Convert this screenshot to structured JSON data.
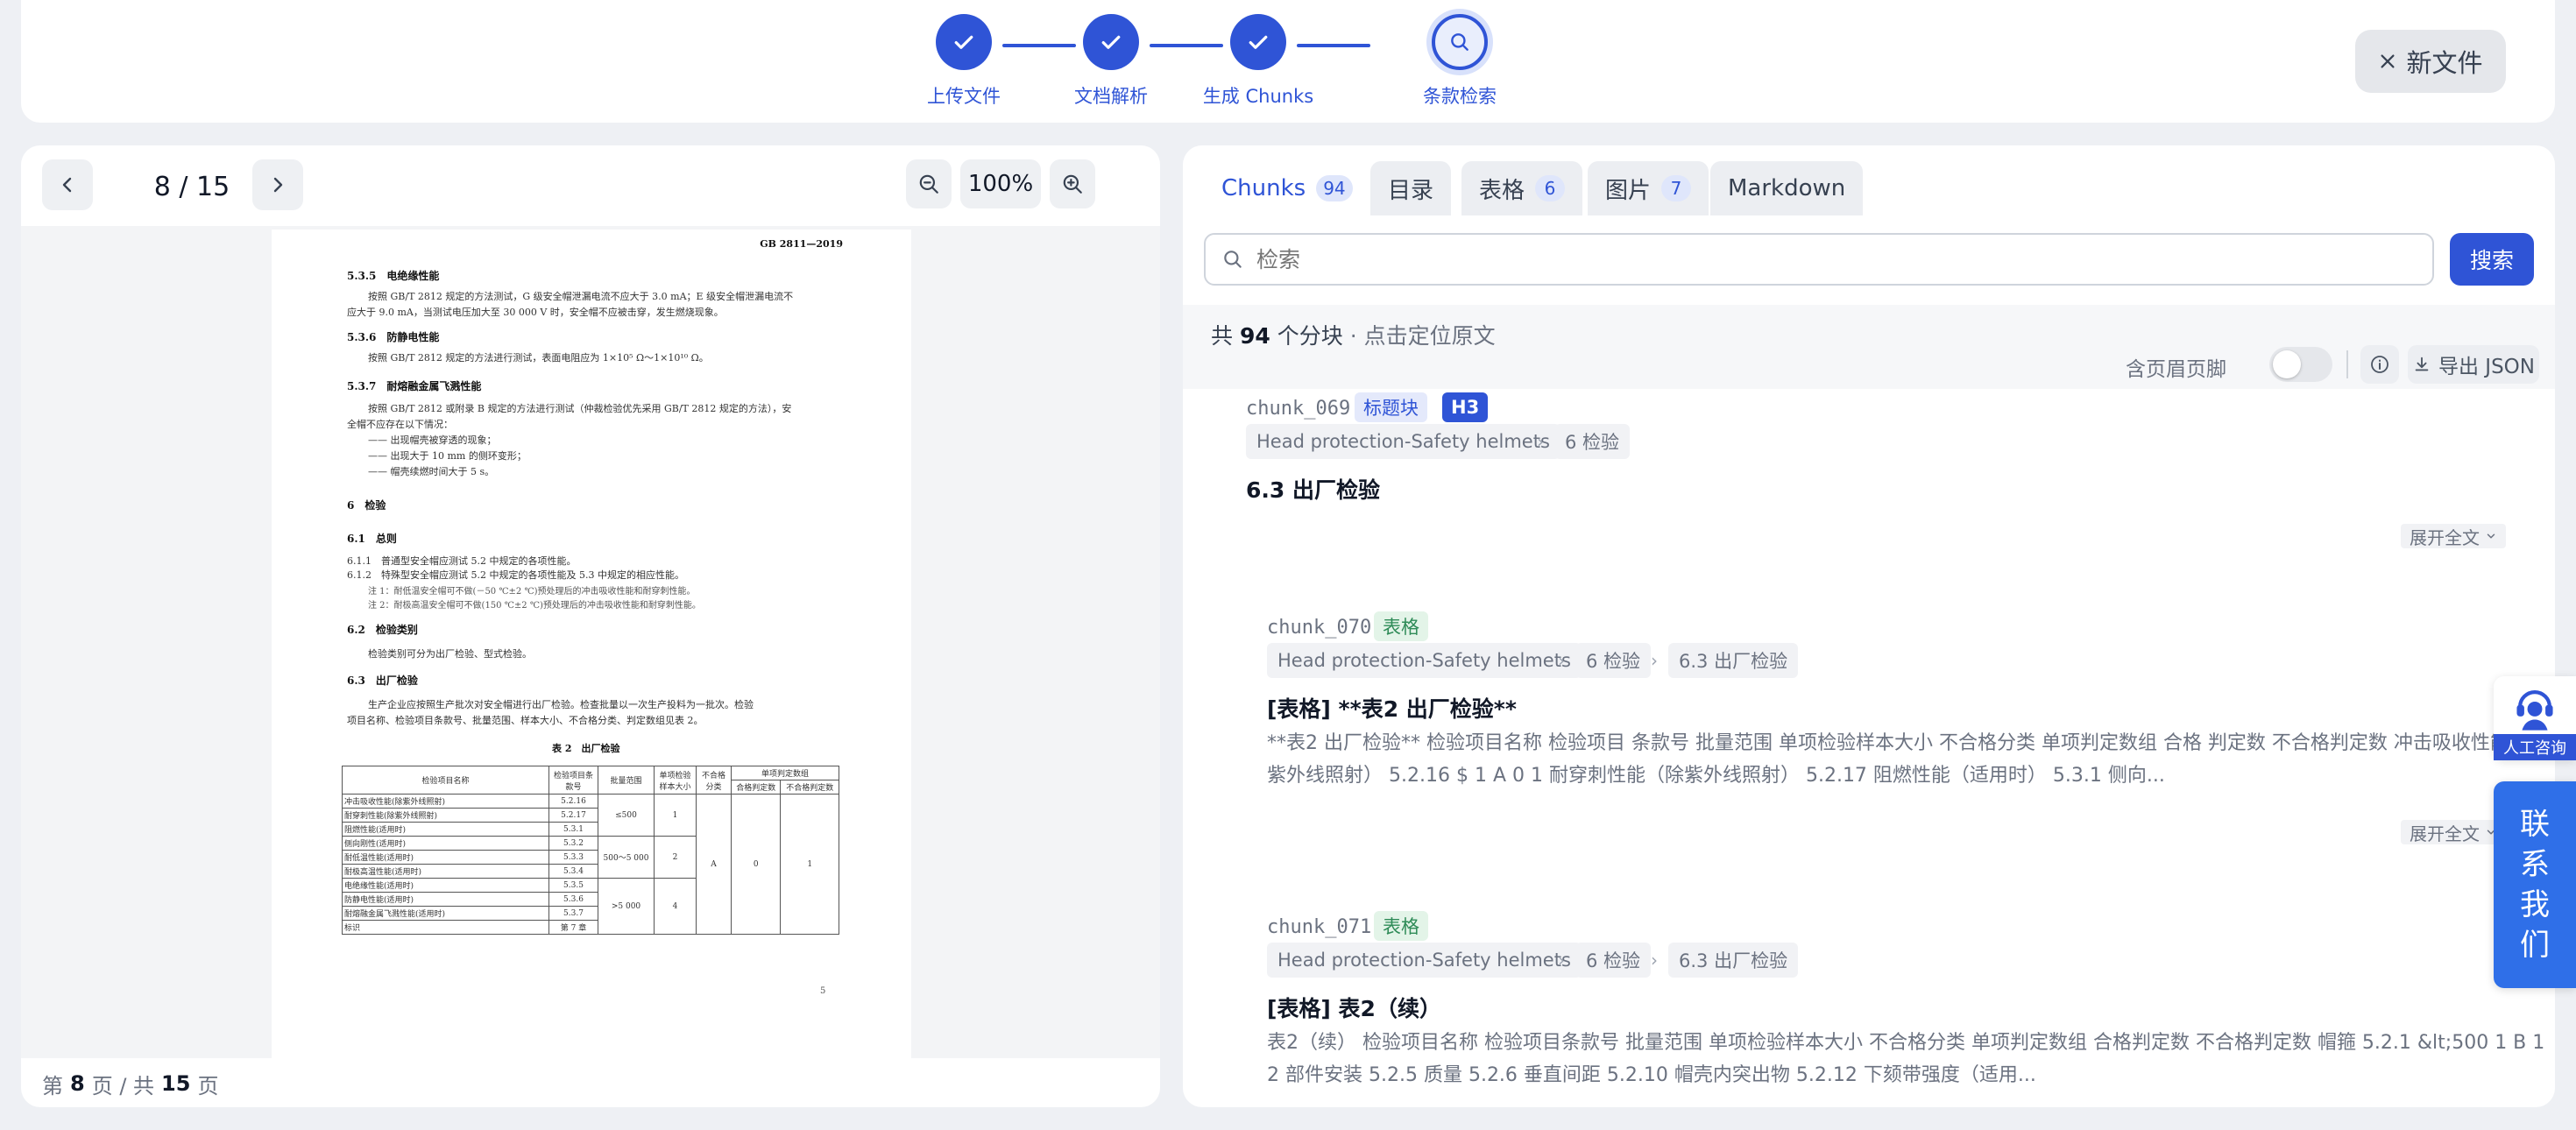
{
  "stepper": {
    "steps": [
      {
        "label": "上传文件"
      },
      {
        "label": "文档解析"
      },
      {
        "label": "生成 Chunks"
      },
      {
        "label": "条款检索"
      }
    ],
    "new_file_label": "新文件"
  },
  "viewer": {
    "current_page": "8",
    "page_indicator": "8 / 15",
    "zoom": "100%",
    "footer": {
      "prefix": "第",
      "page": "8",
      "mid": "页 / 共",
      "total": "15",
      "suffix": "页"
    },
    "pdf": {
      "std_no": "GB 2811—2019",
      "s535_title": "5.3.5　电绝缘性能",
      "s535_l1": "按照 GB/T 2812 规定的方法测试，G 级安全帽泄漏电流不应大于 3.0 mA；E 级安全帽泄漏电流不",
      "s535_l2": "应大于 9.0 mA，当测试电压加大至 30 000 V 时，安全帽不应被击穿，发生燃烧现象。",
      "s536_title": "5.3.6　防静电性能",
      "s536_l1": "按照 GB/T 2812 规定的方法进行测试，表面电阻应为 1×10⁵ Ω～1×10¹⁰ Ω。",
      "s537_title": "5.3.7　耐熔融金属飞溅性能",
      "s537_l1": "按照 GB/T 2812 或附录 B 规定的方法进行测试（仲裁检验优先采用 GB/T 2812 规定的方法），安",
      "s537_l2": "全帽不应存在以下情况：",
      "s537_b1": "—— 出现帽壳被穿透的现象；",
      "s537_b2": "—— 出现大于 10 mm 的侧环变形；",
      "s537_b3": "—— 帽壳续燃时间大于 5 s。",
      "s6_title": "6　检验",
      "s61_title": "6.1　总则",
      "s611": "6.1.1　普通型安全帽应测试 5.2 中规定的各项性能。",
      "s612": "6.1.2　特殊型安全帽应测试 5.2 中规定的各项性能及 5.3 中规定的相应性能。",
      "note1": "注 1：耐低温安全帽可不做(－50 ℃±2 ℃)预处理后的冲击吸收性能和耐穿刺性能。",
      "note2": "注 2：耐极高温安全帽可不做(150 ℃±2 ℃)预处理后的冲击吸收性能和耐穿刺性能。",
      "s62_title": "6.2　检验类别",
      "s62_l1": "检验类别可分为出厂检验、型式检验。",
      "s63_title": "6.3　出厂检验",
      "s63_l1": "生产企业应按照生产批次对安全帽进行出厂检验。检查批量以一次生产投料为一批次。检验",
      "s63_l2": "项目名称、检验项目条款号、批量范围、样本大小、不合格分类、判定数组见表 2。",
      "table_caption": "表 2　出厂检验",
      "table": {
        "h_name": "检验项目名称",
        "h_clause": "检验项目条款号",
        "h_range": "批量范围",
        "h_sample": "单项检验样本大小",
        "h_class": "不合格分类",
        "h_group": "单项判定数组",
        "h_ok": "合格判定数",
        "h_ng": "不合格判定数",
        "rows": [
          {
            "name": "冲击吸收性能(除紫外线照射)",
            "clause": "5.2.16"
          },
          {
            "name": "耐穿刺性能(除紫外线照射)",
            "clause": "5.2.17"
          },
          {
            "name": "阻燃性能(适用时)",
            "clause": "5.3.1"
          },
          {
            "name": "侧向刚性(适用时)",
            "clause": "5.3.2"
          },
          {
            "name": "耐低温性能(适用时)",
            "clause": "5.3.3"
          },
          {
            "name": "耐极高温性能(适用时)",
            "clause": "5.3.4"
          },
          {
            "name": "电绝缘性能(适用时)",
            "clause": "5.3.5"
          },
          {
            "name": "防静电性能(适用时)",
            "clause": "5.3.6"
          },
          {
            "name": "耐熔融金属飞溅性能(适用时)",
            "clause": "5.3.7"
          },
          {
            "name": "标识",
            "clause": "第 7 章"
          }
        ],
        "range1": "≤500",
        "sample1": "1",
        "range2": "500～5 000",
        "sample2": "2",
        "range3": ">5 000",
        "sample3": "4",
        "class": "A",
        "ok": "0",
        "ng": "1"
      },
      "page_no": "5"
    }
  },
  "chunks_panel": {
    "tabs": [
      {
        "label": "Chunks",
        "count": "94"
      },
      {
        "label": "目录",
        "count": ""
      },
      {
        "label": "表格",
        "count": "6"
      },
      {
        "label": "图片",
        "count": "7"
      },
      {
        "label": "Markdown",
        "count": ""
      }
    ],
    "search_placeholder": "检索",
    "search_button": "搜索",
    "count_prefix": "共",
    "count_value": "94",
    "count_suffix": "个分块",
    "count_hint": "· 点击定位原文",
    "toggle_label": "含页眉页脚",
    "export_label": "导出 JSON",
    "chunks": [
      {
        "id": "chunk_069",
        "tags": [
          "标题块",
          "H3"
        ],
        "crumbs": [
          "Head protection-Safety helmets",
          "6 检验"
        ],
        "title": "6.3 出厂检验",
        "body": "",
        "expand": "展开全文"
      },
      {
        "id": "chunk_070",
        "tags": [
          "表格"
        ],
        "crumbs": [
          "Head protection-Safety helmets",
          "6 检验",
          "6.3 出厂检验"
        ],
        "title": "[表格] **表2 出厂检验**",
        "body": "**表2 出厂检验** 检验项目名称 检验项目 条款号 批量范围 单项检验样本大小 不合格分类 单项判定数组 合格 判定数 不合格判定数 冲击吸收性能（除紫外线照射） 5.2.16 $ 1 A 0 1 耐穿刺性能（除紫外线照射） 5.2.17 阻燃性能（适用时） 5.3.1 侧向...",
        "expand": "展开全文"
      },
      {
        "id": "chunk_071",
        "tags": [
          "表格"
        ],
        "crumbs": [
          "Head protection-Safety helmets",
          "6 检验",
          "6.3 出厂检验"
        ],
        "title": "[表格] 表2（续）",
        "body": "表2（续） 检验项目名称 检验项目条款号 批量范围 单项检验样本大小 不合格分类 单项判定数组 合格判定数 不合格判定数 帽箍 5.2.1 &lt;500 1 B 1 2 部件安装 5.2.5 质量 5.2.6 垂直间距 5.2.10 帽壳内突出物 5.2.12 下颏带强度（适用...",
        "expand": ""
      }
    ]
  },
  "widgets": {
    "consult_label": "人工咨询",
    "contact_label": "联系我们"
  },
  "colors": {
    "accent": "#2f54d6",
    "table_tag": "#2e8b57",
    "contact": "#2f6fe8"
  }
}
